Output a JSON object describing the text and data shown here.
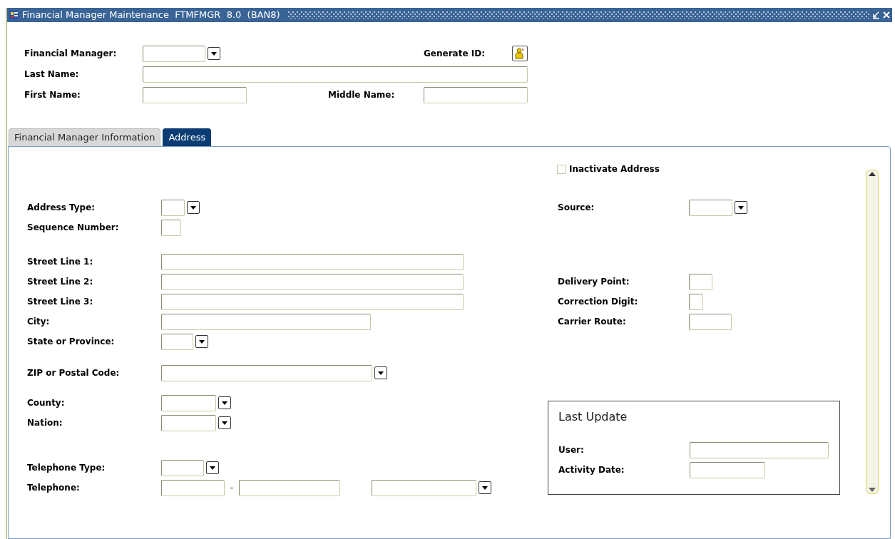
{
  "window": {
    "title": "Financial Manager Maintenance  FTMFMGR  8.0  (BAN8)"
  },
  "key_block": {
    "financial_manager": "Financial Manager:",
    "generate_id": "Generate ID:",
    "last_name": "Last Name:",
    "first_name": "First Name:",
    "middle_name": "Middle Name:"
  },
  "tabs": [
    {
      "label": "Financial Manager Information",
      "selected": false
    },
    {
      "label": "Address",
      "selected": true
    }
  ],
  "address": {
    "inactivate": {
      "label": "Inactivate Address",
      "checked": false
    },
    "address_type": "Address Type:",
    "sequence_number": "Sequence Number:",
    "street_line_1": "Street Line 1:",
    "street_line_2": "Street Line 2:",
    "street_line_3": "Street Line 3:",
    "city": "City:",
    "state": "State or Province:",
    "zip": "ZIP or Postal Code:",
    "county": "County:",
    "nation": "Nation:",
    "telephone_type": "Telephone Type:",
    "telephone": "Telephone:",
    "telephone_separator": "-",
    "source": "Source:",
    "delivery_point": "Delivery Point:",
    "correction_digit": "Correction Digit:",
    "carrier_route": "Carrier Route:",
    "last_update": {
      "title": "Last Update",
      "user": "User:",
      "activity_date": "Activity Date:"
    }
  }
}
